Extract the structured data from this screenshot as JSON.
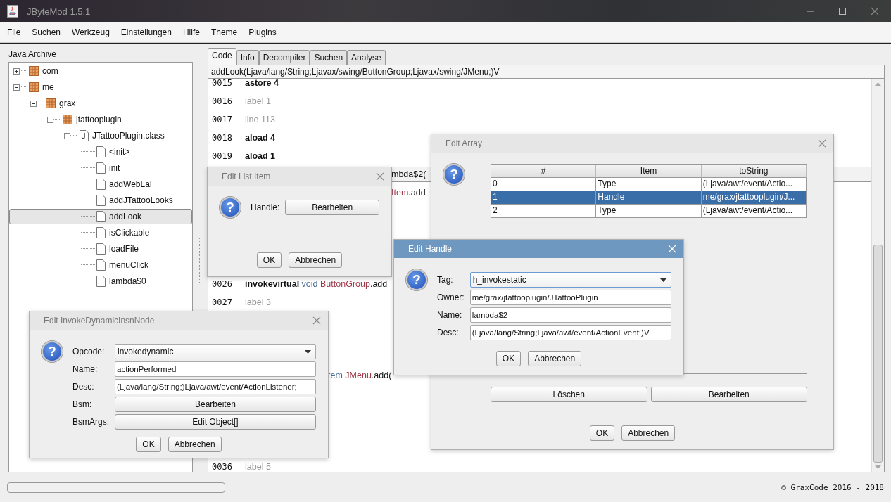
{
  "window": {
    "title": "JByteMod 1.5.1"
  },
  "menu": [
    "File",
    "Suchen",
    "Werkzeug",
    "Einstellungen",
    "Hilfe",
    "Theme",
    "Plugins"
  ],
  "archive": {
    "title": "Java Archive",
    "tree": [
      {
        "label": "com",
        "kind": "package",
        "expanded": false,
        "selected": false
      },
      {
        "label": "me",
        "kind": "package",
        "expanded": true,
        "selected": false,
        "children": [
          {
            "label": "grax",
            "kind": "package",
            "expanded": true,
            "selected": false,
            "children": [
              {
                "label": "jtattooplugin",
                "kind": "package",
                "expanded": true,
                "selected": false,
                "children": [
                  {
                    "label": "JTattooPlugin.class",
                    "kind": "class",
                    "expanded": true,
                    "selected": false,
                    "children": [
                      {
                        "label": "<init>",
                        "kind": "method",
                        "selected": false
                      },
                      {
                        "label": "init",
                        "kind": "method",
                        "selected": false
                      },
                      {
                        "label": "addWebLaF",
                        "kind": "method",
                        "selected": false
                      },
                      {
                        "label": "addJTattooLooks",
                        "kind": "method",
                        "selected": false
                      },
                      {
                        "label": "addLook",
                        "kind": "method",
                        "selected": true
                      },
                      {
                        "label": "isClickable",
                        "kind": "method",
                        "selected": false
                      },
                      {
                        "label": "loadFile",
                        "kind": "method",
                        "selected": false
                      },
                      {
                        "label": "menuClick",
                        "kind": "method",
                        "selected": false
                      },
                      {
                        "label": "lambda$0",
                        "kind": "method",
                        "selected": false
                      }
                    ]
                  }
                ]
              }
            ]
          }
        ]
      }
    ]
  },
  "tabs": [
    {
      "label": "Code",
      "selected": true
    },
    {
      "label": "Info",
      "selected": false
    },
    {
      "label": "Decompiler",
      "selected": false
    },
    {
      "label": "Suchen",
      "selected": false
    },
    {
      "label": "Analyse",
      "selected": false
    }
  ],
  "signature": "addLook(Ljava/lang/String;Ljavax/swing/ButtonGroup;Ljavax/swing/JMenu;)V",
  "code": [
    {
      "kind": "line",
      "number": "0015",
      "selected": false,
      "parts": [
        {
          "text": "astore 4",
          "kind": "opcode"
        }
      ]
    },
    {
      "kind": "line",
      "number": "0016",
      "selected": false,
      "parts": [
        {
          "text": "label 1",
          "kind": "label"
        }
      ]
    },
    {
      "kind": "line",
      "number": "0017",
      "selected": false,
      "parts": [
        {
          "text": "line 113",
          "kind": "label"
        }
      ]
    },
    {
      "kind": "line",
      "number": "0018",
      "selected": false,
      "parts": [
        {
          "text": "aload 4",
          "kind": "opcode"
        }
      ]
    },
    {
      "kind": "line",
      "number": "0019",
      "selected": false,
      "parts": [
        {
          "text": "aload 1",
          "kind": "opcode"
        }
      ]
    },
    {
      "kind": "tail_wide",
      "selected": true,
      "parts": [
        {
          "text": "mbda$2(",
          "kind": "plain"
        }
      ]
    },
    {
      "kind": "tail_wide",
      "selected": false,
      "parts": [
        {
          "text": "Item",
          "kind": "type"
        },
        {
          "text": ".add",
          "kind": "plain"
        }
      ]
    },
    {
      "kind": "covered"
    },
    {
      "kind": "covered"
    },
    {
      "kind": "covered"
    },
    {
      "kind": "covered"
    },
    {
      "kind": "line",
      "number": "0026",
      "selected": false,
      "parts": [
        {
          "text": "invokevirtual",
          "kind": "opcode"
        },
        {
          "text": " void ",
          "kind": "descriptor"
        },
        {
          "text": "ButtonGroup",
          "kind": "type"
        },
        {
          "text": ".add",
          "kind": "plain"
        }
      ]
    },
    {
      "kind": "line",
      "number": "0027",
      "selected": false,
      "parts": [
        {
          "text": "label 3",
          "kind": "label"
        }
      ]
    },
    {
      "kind": "covered"
    },
    {
      "kind": "covered"
    },
    {
      "kind": "covered"
    },
    {
      "kind": "tail_narrow",
      "selected": false,
      "parts": [
        {
          "text": "tem ",
          "kind": "descriptor"
        },
        {
          "text": "JMenu",
          "kind": "type"
        },
        {
          "text": ".add(",
          "kind": "plain"
        }
      ]
    },
    {
      "kind": "covered"
    },
    {
      "kind": "covered"
    },
    {
      "kind": "covered"
    },
    {
      "kind": "covered"
    },
    {
      "kind": "line",
      "number": "0036",
      "selected": false,
      "parts": [
        {
          "text": "label 5",
          "kind": "label"
        }
      ]
    }
  ],
  "dialogs": [
    {
      "title": "Edit Array",
      "active": false,
      "icon": "?",
      "table": {
        "columns": [
          "#",
          "Item",
          "toString"
        ],
        "rows": [
          {
            "cells": [
              "0",
              "Type",
              "(Ljava/awt/event/Actio..."
            ],
            "selected": false
          },
          {
            "cells": [
              "1",
              "Handle",
              "me/grax/jtattooplugin/J..."
            ],
            "selected": true
          },
          {
            "cells": [
              "2",
              "Type",
              "(Ljava/awt/event/Actio..."
            ],
            "selected": false
          }
        ]
      },
      "actions": [
        "Löschen",
        "Bearbeiten"
      ],
      "buttons": [
        "OK",
        "Abbrechen"
      ]
    },
    {
      "title": "Edit List Item",
      "active": false,
      "icon": "?",
      "fields": [
        {
          "label": "Handle:",
          "kind": "button",
          "value": "Bearbeiten"
        }
      ],
      "buttons": [
        "OK",
        "Abbrechen"
      ]
    },
    {
      "title": "Edit InvokeDynamicInsnNode",
      "active": false,
      "icon": "?",
      "fields": [
        {
          "label": "Opcode:",
          "kind": "select",
          "value": "invokedynamic"
        },
        {
          "label": "Name:",
          "kind": "text",
          "value": "actionPerformed"
        },
        {
          "label": "Desc:",
          "kind": "text",
          "value": "(Ljava/lang/String;)Ljava/awt/event/ActionListener;"
        },
        {
          "label": "Bsm:",
          "kind": "button",
          "value": "Bearbeiten"
        },
        {
          "label": "BsmArgs:",
          "kind": "button",
          "value": "Edit Object[]"
        }
      ],
      "buttons": [
        "OK",
        "Abbrechen"
      ]
    },
    {
      "title": "Edit Handle",
      "active": true,
      "icon": "?",
      "fields": [
        {
          "label": "Tag:",
          "kind": "select",
          "value": "h_invokestatic"
        },
        {
          "label": "Owner:",
          "kind": "text",
          "value": "me/grax/jtattooplugin/JTattooPlugin"
        },
        {
          "label": "Name:",
          "kind": "text",
          "value": "lambda$2"
        },
        {
          "label": "Desc:",
          "kind": "text",
          "value": "(Ljava/lang/String;Ljava/awt/event/ActionEvent;)V"
        }
      ],
      "buttons": [
        "OK",
        "Abbrechen"
      ]
    }
  ],
  "status_bar": {
    "progress": {
      "level": 0
    },
    "copyright": "© GraxCode 2016 - 2018"
  }
}
